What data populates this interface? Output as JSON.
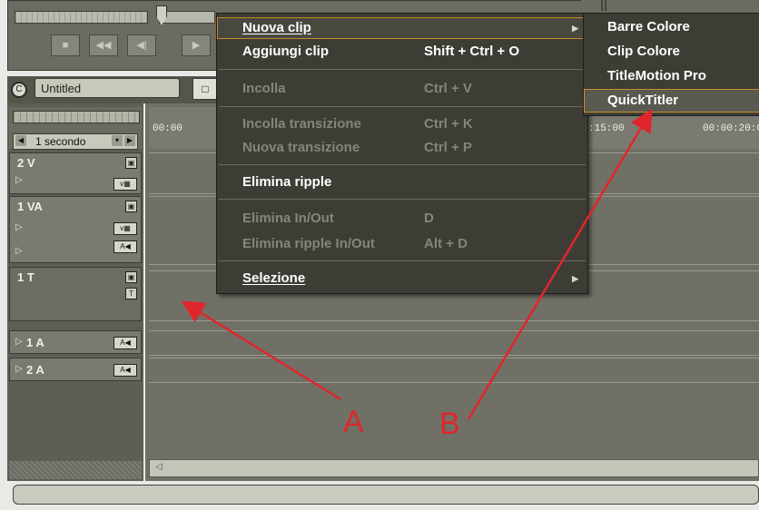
{
  "project": {
    "name": "Untitled",
    "btn_glyph": "□",
    "icon_glyph": "C"
  },
  "transport": {
    "buttons": [
      "■",
      "◀◀",
      "◀|",
      "▶"
    ]
  },
  "zoom": {
    "label": "1 secondo",
    "left": "◀",
    "dropdown": "▾",
    "right": "▶"
  },
  "ruler": {
    "times": [
      "00:00",
      ":15:00",
      "00:00:20:0"
    ]
  },
  "tracks": [
    {
      "name": "2 V"
    },
    {
      "name": "1 VA"
    },
    {
      "name": "1 T"
    },
    {
      "name": "1 A"
    },
    {
      "name": "2 A"
    }
  ],
  "menu": {
    "items": [
      {
        "label": "Nuova clip",
        "shortcut": "",
        "enabled": true,
        "submenu": true,
        "highlight": true
      },
      {
        "label": "Aggiungi clip",
        "shortcut": "Shift + Ctrl + O",
        "enabled": true
      },
      {
        "label": "Incolla",
        "shortcut": "Ctrl + V",
        "enabled": false
      },
      {
        "label": "Incolla transizione",
        "shortcut": "Ctrl + K",
        "enabled": false
      },
      {
        "label": "Nuova transizione",
        "shortcut": "Ctrl + P",
        "enabled": false
      },
      {
        "label": "Elimina ripple",
        "shortcut": "",
        "enabled": true
      },
      {
        "label": "Elimina In/Out",
        "shortcut": "D",
        "enabled": false
      },
      {
        "label": "Elimina ripple In/Out",
        "shortcut": "Alt + D",
        "enabled": false
      },
      {
        "label": "Selezione",
        "shortcut": "",
        "enabled": true,
        "submenu": true
      }
    ],
    "submenu_glyph": "▶"
  },
  "submenu": {
    "items": [
      {
        "label": "Barre Colore"
      },
      {
        "label": "Clip Colore"
      },
      {
        "label": "TitleMotion Pro"
      },
      {
        "label": "QuickTitler",
        "highlight": true
      }
    ]
  },
  "annotations": {
    "a": "A",
    "b": "B",
    "color": "#e0262a"
  },
  "colors": {
    "menu_bg": "#3d3d36",
    "highlight_border": "#c78a2a",
    "panel": "#707067"
  }
}
